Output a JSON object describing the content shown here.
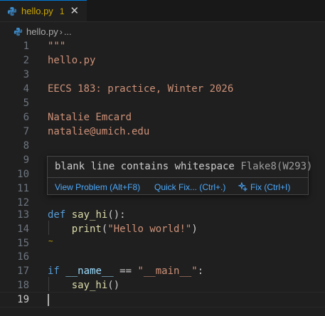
{
  "tab": {
    "filename": "hello.py",
    "problem_count": "1",
    "close": "✕"
  },
  "breadcrumb": {
    "file": "hello.py",
    "separator": "›",
    "more": "..."
  },
  "editor": {
    "active_line": "19",
    "lines": [
      {
        "n": "1",
        "text": "\"\"\""
      },
      {
        "n": "2",
        "text": "hello.py"
      },
      {
        "n": "3",
        "text": ""
      },
      {
        "n": "4",
        "text": "EECS 183: practice, Winter 2026"
      },
      {
        "n": "5",
        "text": ""
      },
      {
        "n": "6",
        "text": "Natalie Emcard"
      },
      {
        "n": "7",
        "text": "natalie@umich.edu"
      },
      {
        "n": "8",
        "text": ""
      },
      {
        "n": "9",
        "text": ""
      },
      {
        "n": "10",
        "text": ""
      },
      {
        "n": "11",
        "text": ""
      },
      {
        "n": "12",
        "text": ""
      },
      {
        "n": "13",
        "def": "def",
        "name": "say_hi",
        "rest": "():"
      },
      {
        "n": "14",
        "call": "print",
        "open": "(",
        "arg": "\"Hello world!\"",
        "close": ")"
      },
      {
        "n": "15",
        "text": ""
      },
      {
        "n": "16",
        "text": ""
      },
      {
        "n": "17",
        "kw": "if",
        "var": "__name__",
        "op": " == ",
        "str": "\"__main__\"",
        "colon": ":"
      },
      {
        "n": "18",
        "call": "say_hi",
        "rest": "()"
      },
      {
        "n": "19",
        "text": ""
      }
    ]
  },
  "hover": {
    "message": "blank line contains whitespace",
    "source": "Flake8(W293)",
    "actions": {
      "view_problem": "View Problem (Alt+F8)",
      "quick_fix": "Quick Fix... (Ctrl+.)",
      "fix": "Fix (Ctrl+I)"
    }
  },
  "colors": {
    "background": "#1f1f1f",
    "warning": "#cca700",
    "string": "#ce9178",
    "keyword": "#569cd6",
    "function": "#dcdcaa",
    "link": "#4daafc"
  }
}
